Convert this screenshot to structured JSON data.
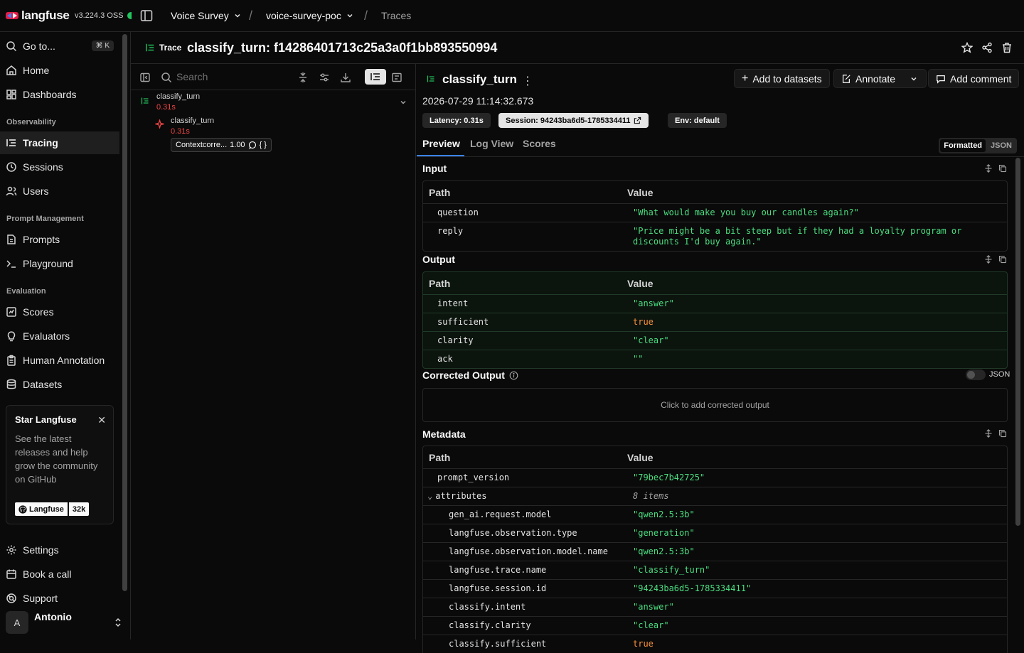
{
  "app": {
    "logo": "langfuse",
    "version": "v3.224.3 OSS"
  },
  "breadcrumb": {
    "org": "Voice Survey",
    "project": "voice-survey-poc",
    "page": "Traces"
  },
  "sidebar": {
    "goto": {
      "label": "Go to...",
      "shortcut": "⌘ K"
    },
    "items_top": [
      {
        "label": "Home",
        "icon": "home-icon"
      },
      {
        "label": "Dashboards",
        "icon": "dashboard-icon"
      }
    ],
    "section_observability": "Observability",
    "items_observability": [
      {
        "label": "Tracing",
        "icon": "tracing-icon",
        "active": true
      },
      {
        "label": "Sessions",
        "icon": "clock-icon"
      },
      {
        "label": "Users",
        "icon": "users-icon"
      }
    ],
    "section_prompt": "Prompt Management",
    "items_prompt": [
      {
        "label": "Prompts",
        "icon": "file-icon"
      },
      {
        "label": "Playground",
        "icon": "terminal-icon"
      }
    ],
    "section_eval": "Evaluation",
    "items_eval": [
      {
        "label": "Scores",
        "icon": "scores-icon"
      },
      {
        "label": "Evaluators",
        "icon": "lightbulb-icon"
      },
      {
        "label": "Human Annotation",
        "icon": "clipboard-icon"
      },
      {
        "label": "Datasets",
        "icon": "database-icon"
      }
    ],
    "star_card": {
      "title": "Star Langfuse",
      "text": "See the latest releases and help grow the community on GitHub",
      "github_label": "Langfuse",
      "github_count": "32k"
    },
    "items_bottom": [
      {
        "label": "Settings",
        "icon": "gear-icon"
      },
      {
        "label": "Book a call",
        "icon": "calendar-icon"
      },
      {
        "label": "Support",
        "icon": "support-icon"
      }
    ],
    "user": {
      "initial": "A",
      "name": "Antonio"
    }
  },
  "trace": {
    "tag": "Trace",
    "title": "classify_turn: f14286401713c25a3a0f1bb893550994"
  },
  "tree": {
    "search_placeholder": "Search",
    "root": {
      "name": "classify_turn",
      "latency": "0.31s"
    },
    "child": {
      "name": "classify_turn",
      "latency": "0.31s"
    },
    "score": {
      "name": "Contextcorre...",
      "value": "1.00",
      "extra": "{ }"
    }
  },
  "detail": {
    "title": "classify_turn",
    "buttons": {
      "add_datasets": "Add to datasets",
      "annotate": "Annotate",
      "add_comment": "Add comment"
    },
    "timestamp": "2026-07-29 11:14:32.673",
    "badges": {
      "latency": "Latency: 0.31s",
      "session": "Session: 94243ba6d5-1785334411",
      "env": "Env: default"
    },
    "tabs": [
      "Preview",
      "Log View",
      "Scores"
    ],
    "format_toggle": {
      "a": "Formatted",
      "b": "JSON"
    },
    "input": {
      "title": "Input",
      "col_path": "Path",
      "col_value": "Value",
      "rows": [
        {
          "k": "question",
          "v": "\"What would make you buy our candles again?\""
        },
        {
          "k": "reply",
          "v": "\"Price might be a bit steep but if they had a loyalty program or discounts I'd buy again.\""
        }
      ]
    },
    "output": {
      "title": "Output",
      "col_path": "Path",
      "col_value": "Value",
      "rows": [
        {
          "k": "intent",
          "v": "\"answer\""
        },
        {
          "k": "sufficient",
          "v": "true"
        },
        {
          "k": "clarity",
          "v": "\"clear\""
        },
        {
          "k": "ack",
          "v": "\"\""
        }
      ]
    },
    "corrected": {
      "title": "Corrected Output",
      "toggle_label": "JSON",
      "placeholder": "Click to add corrected output"
    },
    "metadata": {
      "title": "Metadata",
      "col_path": "Path",
      "col_value": "Value",
      "rows": [
        {
          "k": "prompt_version",
          "v": "\"79bec7b42725\""
        },
        {
          "k": "attributes",
          "v": "8 items"
        },
        {
          "k": "gen_ai.request.model",
          "v": "\"qwen2.5:3b\""
        },
        {
          "k": "langfuse.observation.type",
          "v": "\"generation\""
        },
        {
          "k": "langfuse.observation.model.name",
          "v": "\"qwen2.5:3b\""
        },
        {
          "k": "langfuse.trace.name",
          "v": "\"classify_turn\""
        },
        {
          "k": "langfuse.session.id",
          "v": "\"94243ba6d5-1785334411\""
        },
        {
          "k": "classify.intent",
          "v": "\"answer\""
        },
        {
          "k": "classify.clarity",
          "v": "\"clear\""
        },
        {
          "k": "classify.sufficient",
          "v": "true"
        }
      ]
    }
  }
}
